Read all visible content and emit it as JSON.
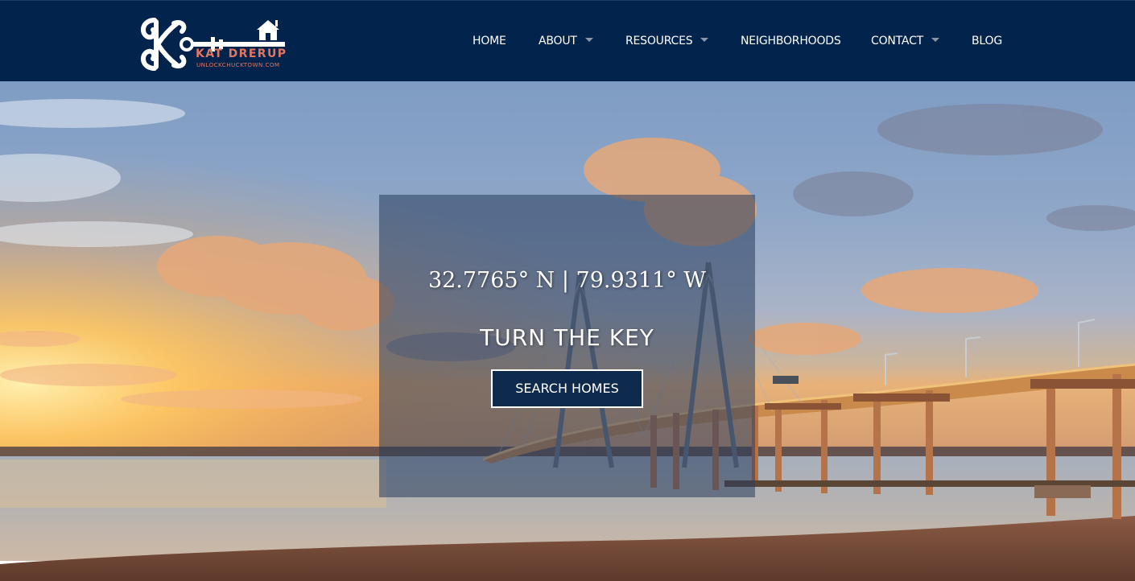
{
  "brand": {
    "name": "KAT DRERUP",
    "url": "UNLOCKCHUCKTOWN.COM",
    "logo_color": "#e27660"
  },
  "nav": {
    "items": [
      {
        "label": "HOME",
        "has_dropdown": false
      },
      {
        "label": "ABOUT",
        "has_dropdown": true
      },
      {
        "label": "RESOURCES",
        "has_dropdown": true
      },
      {
        "label": "NEIGHBORHOODS",
        "has_dropdown": false
      },
      {
        "label": "CONTACT",
        "has_dropdown": true
      },
      {
        "label": "BLOG",
        "has_dropdown": false
      }
    ],
    "background": "#02234b"
  },
  "hero": {
    "coordinates": "32.7765° N | 79.9311° W",
    "tagline": "TURN THE KEY",
    "cta_label": "SEARCH HOMES",
    "background_image": "sunset-bridge-over-harbor"
  },
  "icons": {
    "logo_key": "skeleton-key-icon",
    "logo_house": "house-icon",
    "dropdown": "chevron-down-icon"
  }
}
